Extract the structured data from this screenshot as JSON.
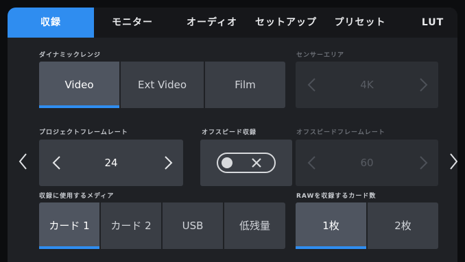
{
  "tabs": [
    {
      "label": "収録",
      "active": true
    },
    {
      "label": "モニター",
      "active": false
    },
    {
      "label": "オーディオ",
      "active": false
    },
    {
      "label": "セットアップ",
      "active": false
    },
    {
      "label": "プリセット",
      "active": false
    },
    {
      "label": "LUT",
      "active": false
    }
  ],
  "dynamic_range": {
    "label": "ダイナミックレンジ",
    "options": [
      "Video",
      "Ext Video",
      "Film"
    ],
    "selected": "Video"
  },
  "sensor_area": {
    "label": "センサーエリア",
    "value": "4K",
    "enabled": false
  },
  "project_frame_rate": {
    "label": "プロジェクトフレームレート",
    "value": "24"
  },
  "off_speed_recording": {
    "label": "オフスピード収録",
    "state": "off"
  },
  "off_speed_frame_rate": {
    "label": "オフスピードフレームレート",
    "value": "60",
    "enabled": false
  },
  "recording_media": {
    "label": "収録に使用するメディア",
    "options": [
      "カード 1",
      "カード 2",
      "USB",
      "低残量"
    ],
    "selected": "カード 1"
  },
  "raw_card_count": {
    "label": "RAWを収録するカード数",
    "options": [
      "1枚",
      "2枚"
    ],
    "selected": "1枚"
  },
  "pagination": {
    "pages": 3,
    "current": 1
  },
  "colors": {
    "accent": "#2f8df0"
  }
}
